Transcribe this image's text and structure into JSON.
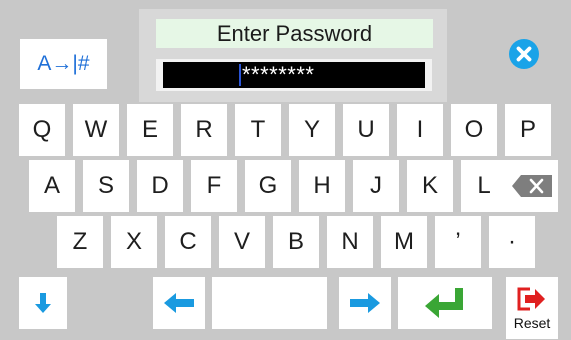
{
  "header": {
    "title": "Enter Password",
    "password_masked": "********"
  },
  "mode_toggle": {
    "label": "A→|#"
  },
  "rows": [
    [
      "Q",
      "W",
      "E",
      "R",
      "T",
      "Y",
      "U",
      "I",
      "O",
      "P"
    ],
    [
      "A",
      "S",
      "D",
      "F",
      "G",
      "H",
      "J",
      "K",
      "L"
    ],
    [
      "Z",
      "X",
      "C",
      "V",
      "B",
      "N",
      "M",
      "’",
      "·"
    ]
  ],
  "bottom": {
    "reset_label": "Reset"
  },
  "colors": {
    "accent_blue": "#1a9ae0",
    "enter_green": "#3aa635",
    "reset_red": "#e02020",
    "background": "#c8c8c8"
  },
  "icons": [
    "close-icon",
    "backspace-icon",
    "down-arrow-icon",
    "left-arrow-icon",
    "right-arrow-icon",
    "enter-icon",
    "exit-icon"
  ]
}
